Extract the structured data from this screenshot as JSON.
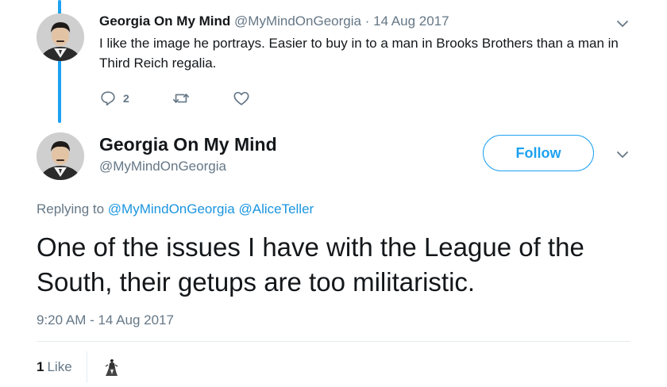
{
  "parent_tweet": {
    "author_name": "Georgia On My Mind",
    "handle": "@MyMindOnGeorgia",
    "separator": "·",
    "date": "14 Aug 2017",
    "text": "I like the image he portrays.  Easier to buy in to a man in Brooks Brothers than a man in Third Reich regalia.",
    "reply_count": "2",
    "icons": {
      "reply": "reply-icon",
      "retweet": "retweet-icon",
      "like": "heart-icon",
      "menu": "chevron-down-icon"
    }
  },
  "main_tweet": {
    "author_name": "Georgia On My Mind",
    "handle": "@MyMindOnGeorgia",
    "follow_label": "Follow",
    "replying_prefix": "Replying to",
    "replying_to": [
      "@MyMindOnGeorgia",
      "@AliceTeller"
    ],
    "text": "One of the issues I have with the League of the South, their getups are too militaristic.",
    "timestamp": "9:20 AM - 14 Aug 2017",
    "likes_count": "1",
    "likes_label": "Like"
  },
  "colors": {
    "accent": "#1da1f2",
    "link": "#1b95e0",
    "muted_text": "#657786",
    "primary_text": "#14171a",
    "divider": "#e6ecf0"
  }
}
